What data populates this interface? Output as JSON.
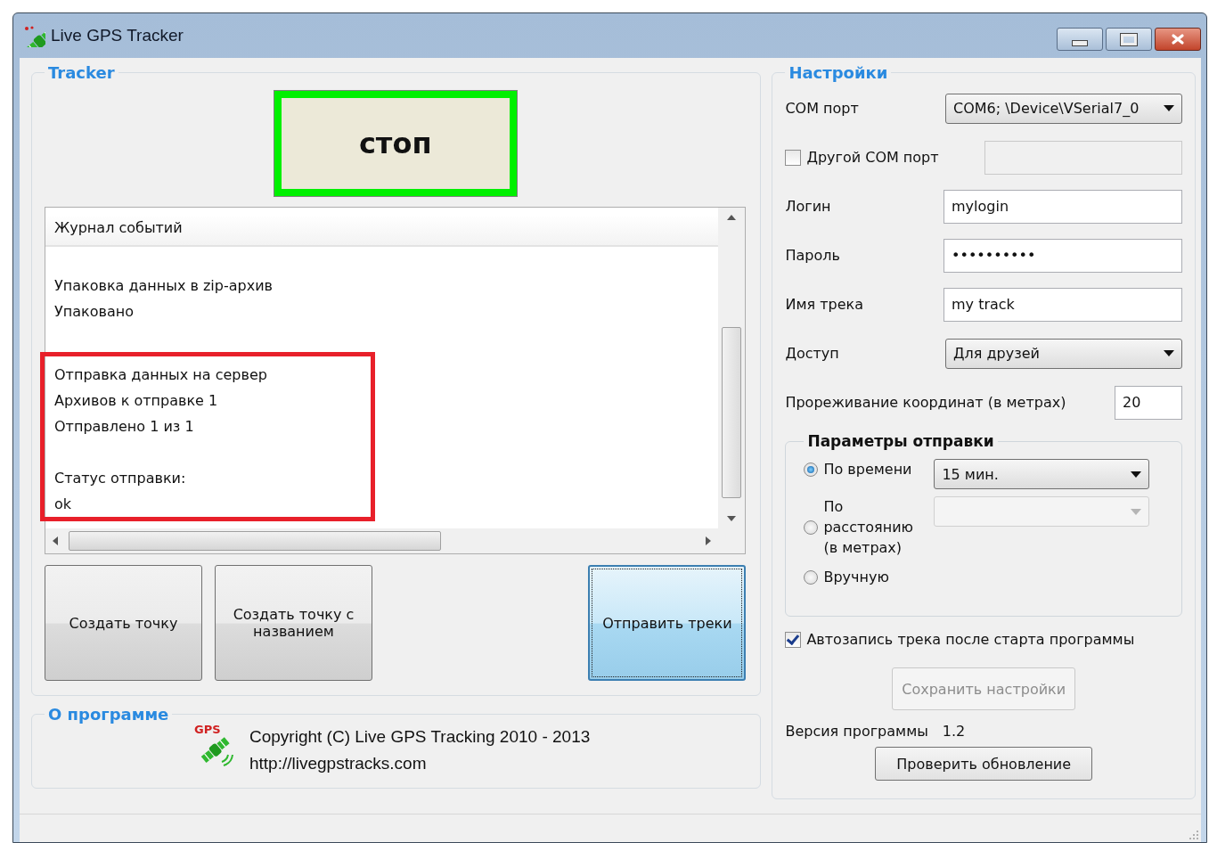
{
  "window": {
    "title": "Live GPS Tracker"
  },
  "tracker": {
    "title": "Tracker",
    "stop_button": {
      "label": "стоп",
      "active": true
    },
    "log": {
      "header": "Журнал событий",
      "lines": [
        {
          "kind": "blank"
        },
        {
          "kind": "text",
          "text": "Упаковка данных в zip-архив",
          "highlighted": false
        },
        {
          "kind": "text",
          "text": "Упаковано",
          "highlighted": false
        },
        {
          "kind": "blank"
        },
        {
          "kind": "text",
          "text": "Отправка данных на сервер",
          "highlighted": true
        },
        {
          "kind": "text",
          "text": "Архивов к отправке 1",
          "highlighted": true
        },
        {
          "kind": "text",
          "text": "Отправлено 1 из 1",
          "highlighted": true
        },
        {
          "kind": "blank"
        },
        {
          "kind": "text",
          "text": "Статус отправки:",
          "highlighted": true
        },
        {
          "kind": "text",
          "text": "ok",
          "highlighted": true
        }
      ]
    },
    "buttons": [
      {
        "label": "Создать точку",
        "focused": false
      },
      {
        "label": "Создать точку с названием",
        "focused": false
      },
      {
        "label": "Отправить треки",
        "focused": true
      }
    ]
  },
  "about": {
    "title": "О программе",
    "logo_text": "GPS",
    "copyright": "Copyright (C) Live GPS Tracking 2010 - 2013",
    "url": "http://livegpstracks.com"
  },
  "settings": {
    "title": "Настройки",
    "fields": [
      {
        "kind": "select",
        "label": "COM порт",
        "value": "COM6; \\Device\\VSerial7_0"
      },
      {
        "kind": "checkbox-input",
        "label": "Другой COM порт",
        "checked": false
      },
      {
        "kind": "input",
        "label": "Логин",
        "value": "mylogin"
      },
      {
        "kind": "input",
        "label": "Пароль",
        "value": "••••••••••"
      },
      {
        "kind": "input",
        "label": "Имя трека",
        "value": "my track"
      },
      {
        "kind": "select",
        "label": "Доступ",
        "value": "Для друзей"
      },
      {
        "kind": "short-input",
        "label": "Прореживание координат (в метрах)",
        "value": "20"
      }
    ],
    "send_params": {
      "title": "Параметры отправки",
      "options": [
        {
          "label": "По времени",
          "selected": true,
          "select": {
            "value": "15 мин.",
            "disabled": false
          }
        },
        {
          "label": "По расстоянию (в метрах)",
          "selected": false,
          "select": {
            "disabled": true
          }
        },
        {
          "label": "Вручную",
          "selected": false
        }
      ]
    },
    "autostart": {
      "label": "Автозапись трека после старта программы",
      "checked": true
    },
    "save_button": {
      "label": "Сохранить настройки",
      "disabled": true
    },
    "version_label": "Версия программы",
    "version": "1.2",
    "update_button": {
      "label": "Проверить обновление"
    }
  }
}
